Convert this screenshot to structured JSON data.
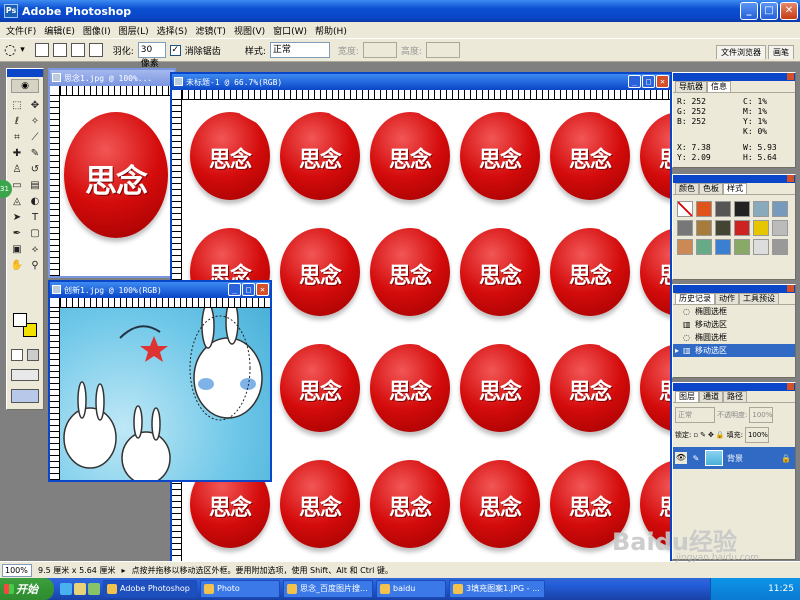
{
  "app": {
    "title": "Adobe Photoshop",
    "icon_letters": "Ps"
  },
  "menu": [
    "文件(F)",
    "编辑(E)",
    "图像(I)",
    "图层(L)",
    "选择(S)",
    "滤镜(T)",
    "视图(V)",
    "窗口(W)",
    "帮助(H)"
  ],
  "options": {
    "feather_label": "羽化:",
    "feather_value": "30 像素",
    "antialias_label": "消除锯齿",
    "style_label": "样式:",
    "style_value": "正常",
    "width_label": "宽度:",
    "height_label": "高度:",
    "tab_file_browser": "文件浏览器",
    "tab_brushes": "画笔"
  },
  "docs": {
    "sinian_title": "思念1.jpg @ 100%...",
    "untitled_title": "未标题-1 @ 66.7%(RGB)",
    "chuangxin_title": "创新1.jpg @ 100%(RGB)",
    "badge_text": "思念"
  },
  "navigator": {
    "tabs": [
      "导航器",
      "信息"
    ],
    "rgb": {
      "r": "252",
      "g": "252",
      "b": "252"
    },
    "cmyk": {
      "c": "1%",
      "m": "1%",
      "y": "1%",
      "k": "0%"
    },
    "x": "7.38",
    "y": "2.09",
    "w": "5.93",
    "h": "5.64"
  },
  "swatches": {
    "tabs": [
      "颜色",
      "色板",
      "样式"
    ]
  },
  "history": {
    "tabs": [
      "历史记录",
      "动作",
      "工具预设"
    ],
    "items": [
      "椭圆选框",
      "移动选区",
      "椭圆选框",
      "移动选区"
    ]
  },
  "layers": {
    "tabs": [
      "图层",
      "通道",
      "路径"
    ],
    "mode": "正常",
    "opacity_label": "不透明度:",
    "opacity_value": "100%",
    "lock_label": "锁定:",
    "fill_label": "填充:",
    "fill_value": "100%",
    "layer_name": "背景"
  },
  "status": {
    "zoom": "100%",
    "doc_size": "9.5 厘米 x 5.64 厘米",
    "hint": "点按并拖移以移动选区外框。要用附加选项，使用 Shift、Alt 和 Ctrl 键。"
  },
  "taskbar": {
    "start_label": "开始",
    "tasks": [
      "Adobe Photoshop",
      "Photo",
      "思念_百度图片搜...",
      "baidu",
      "3填充图案1.JPG - ..."
    ],
    "clock": "11:25"
  },
  "watermark": {
    "brand": "Baidu经验",
    "url": "jingyan.baidu.com"
  },
  "colors": {
    "accent": "#0a46c7",
    "badge_red": "#d40b0b",
    "foreground_swatch": "#ffffff",
    "background_swatch": "#f2e000"
  }
}
